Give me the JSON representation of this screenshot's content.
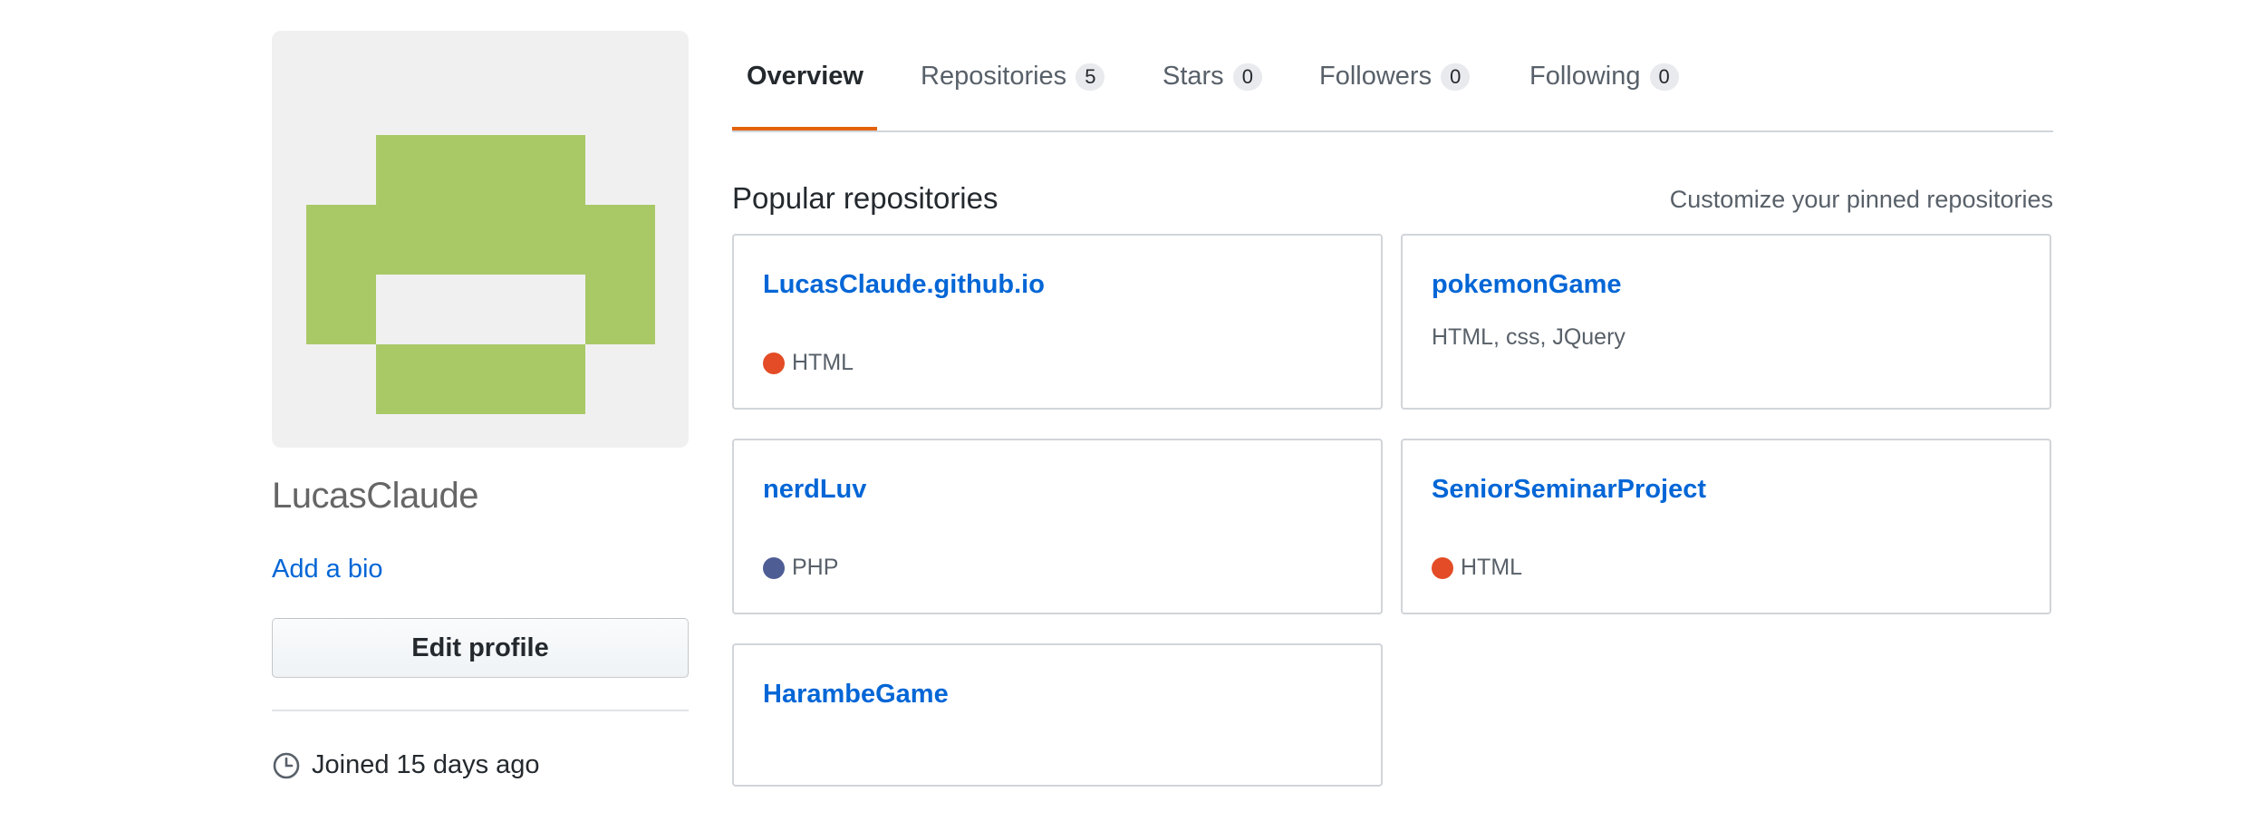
{
  "colors": {
    "link": "#0366d6",
    "avatar_green": "#a9c967",
    "avatar_bg": "#f0f0f0",
    "tab_selected_underline": "#e36209",
    "lang_html": "#e34c26",
    "lang_php": "#4f5d95"
  },
  "profile": {
    "username": "LucasClaude",
    "add_bio_label": "Add a bio",
    "edit_profile_label": "Edit profile",
    "joined_text": "Joined 15 days ago",
    "joined_icon": "clock-icon"
  },
  "tabs": [
    {
      "label": "Overview",
      "count": null,
      "selected": true
    },
    {
      "label": "Repositories",
      "count": "5",
      "selected": false
    },
    {
      "label": "Stars",
      "count": "0",
      "selected": false
    },
    {
      "label": "Followers",
      "count": "0",
      "selected": false
    },
    {
      "label": "Following",
      "count": "0",
      "selected": false
    }
  ],
  "pinned": {
    "title": "Popular repositories",
    "customize_label": "Customize your pinned repositories",
    "repos": [
      {
        "name": "LucasClaude.github.io",
        "description": "",
        "language": "HTML"
      },
      {
        "name": "pokemonGame",
        "description": "HTML, css, JQuery",
        "language": ""
      },
      {
        "name": "nerdLuv",
        "description": "",
        "language": "PHP"
      },
      {
        "name": "SeniorSeminarProject",
        "description": "",
        "language": "HTML"
      },
      {
        "name": "HarambeGame",
        "description": "",
        "language": ""
      }
    ]
  }
}
